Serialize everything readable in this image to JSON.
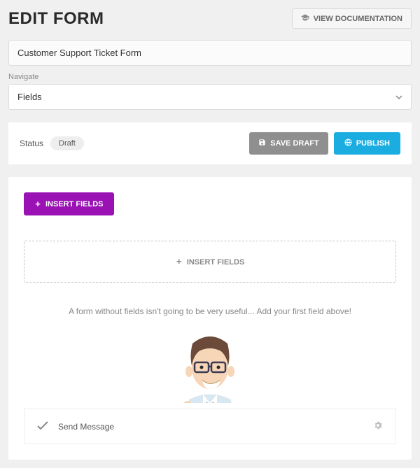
{
  "header": {
    "title": "EDIT FORM",
    "documentation_label": "VIEW DOCUMENTATION"
  },
  "form": {
    "title_value": "Customer Support Ticket Form"
  },
  "navigate": {
    "label": "Navigate",
    "selected": "Fields"
  },
  "status": {
    "label": "Status",
    "value": "Draft",
    "save_draft_label": "SAVE DRAFT",
    "publish_label": "PUBLISH"
  },
  "panel": {
    "insert_button_label": "INSERT FIELDS",
    "dropzone_label": "INSERT FIELDS",
    "empty_message": "A form without fields isn't going to be very useful... Add your first field above!"
  },
  "action_row": {
    "label": "Send Message"
  }
}
